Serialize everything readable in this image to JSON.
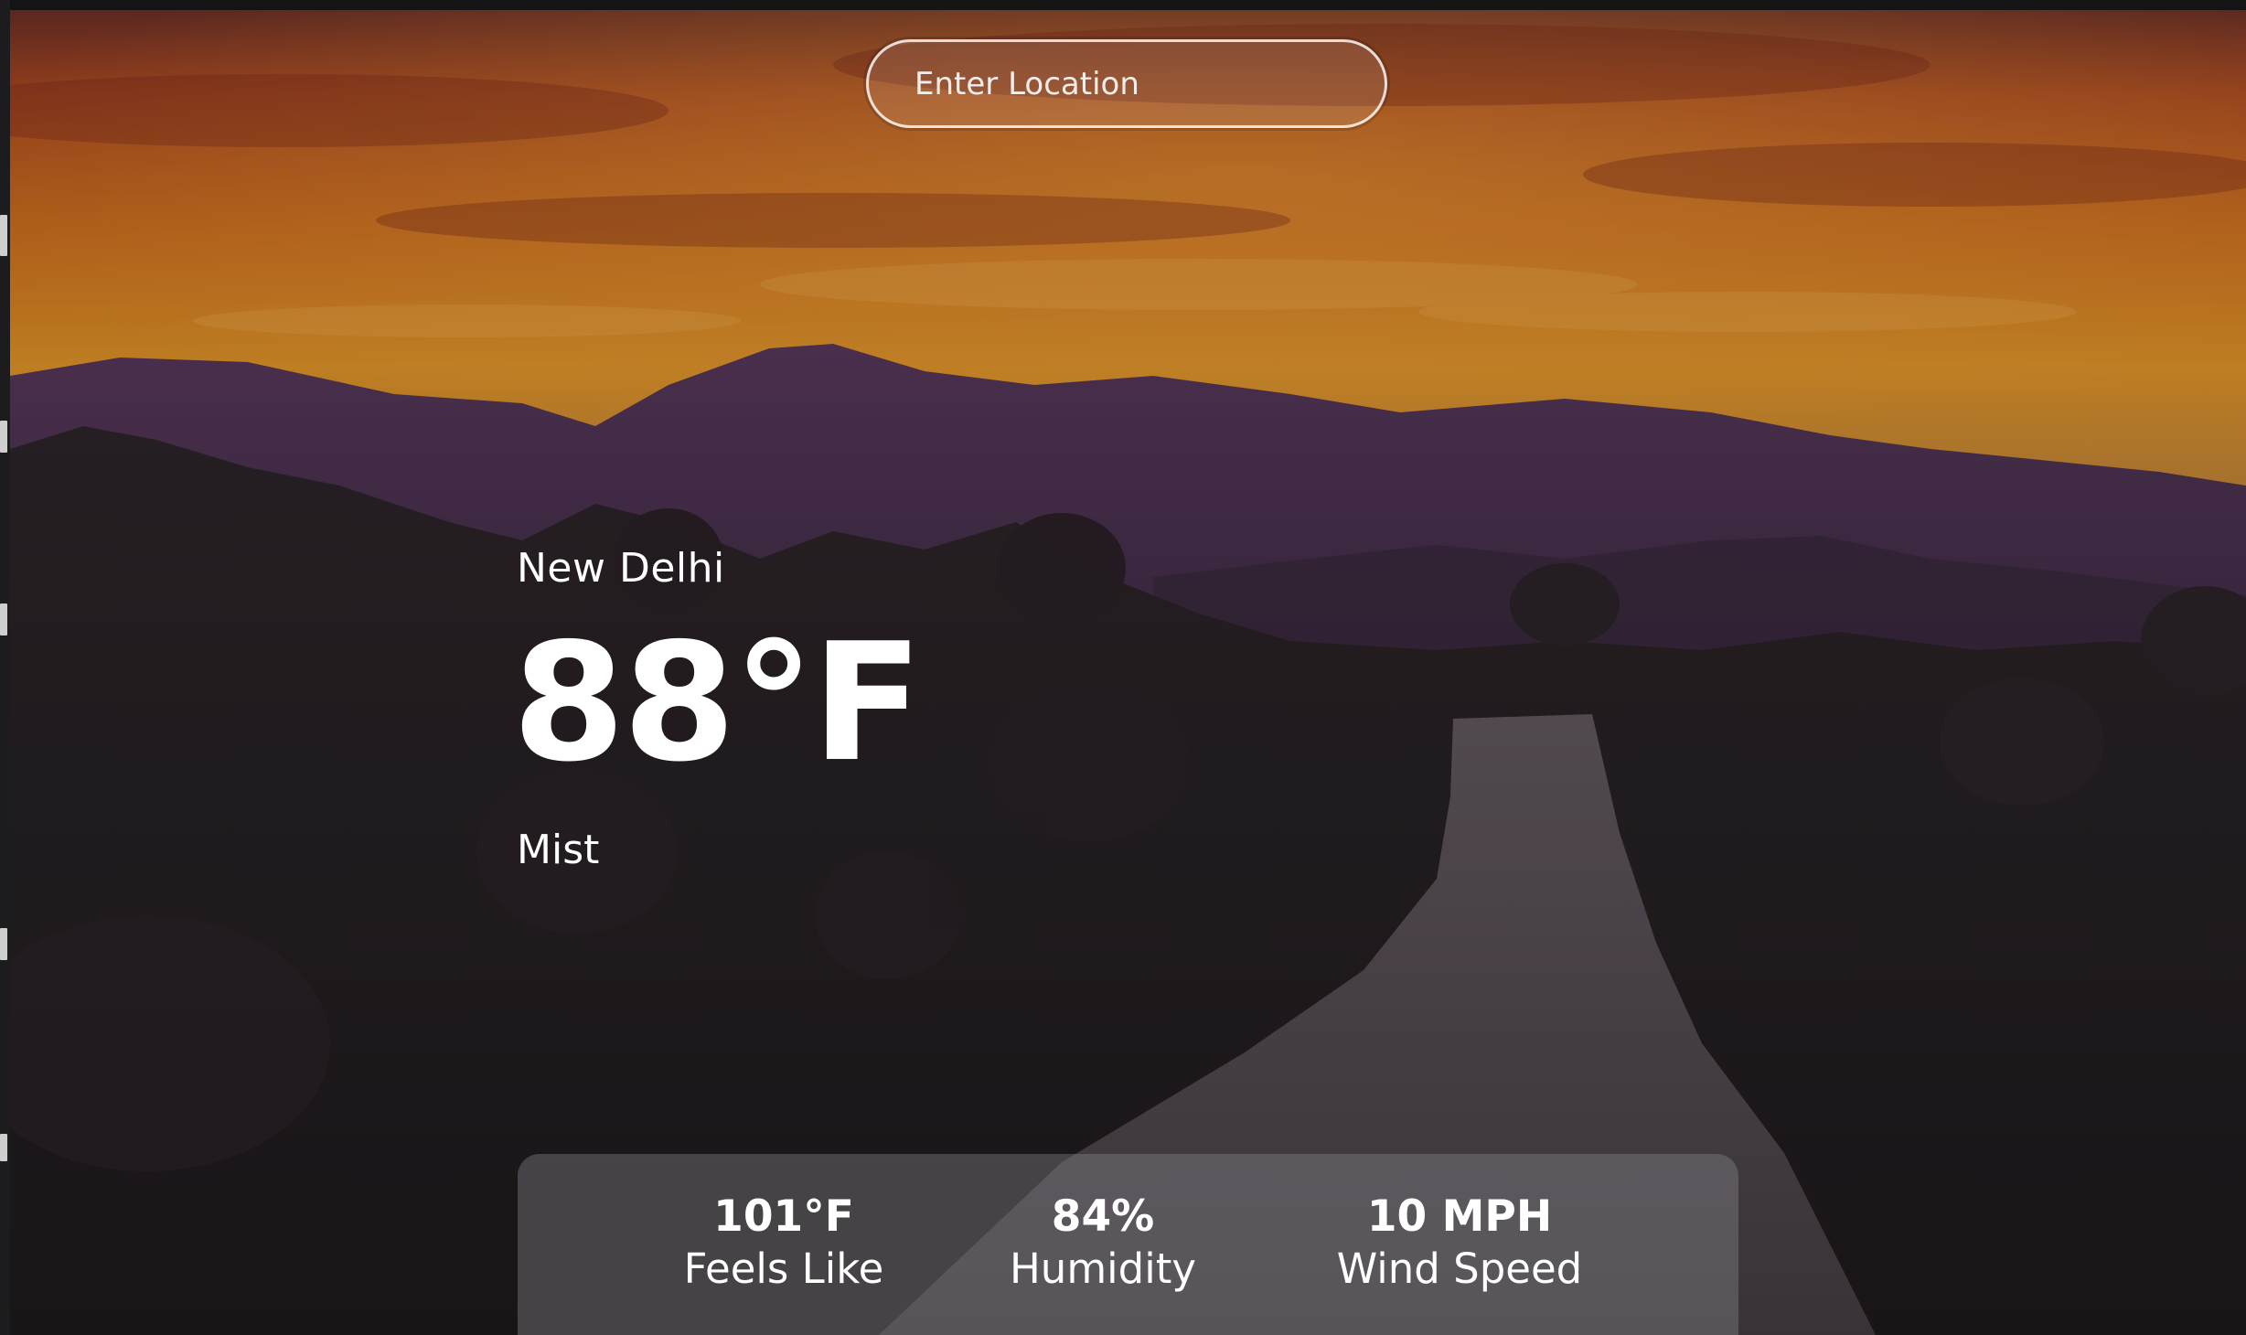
{
  "search": {
    "placeholder": "Enter Location",
    "value": ""
  },
  "weather": {
    "city": "New Delhi",
    "temperature": "88°F",
    "condition": "Mist"
  },
  "stats": {
    "feels_like": {
      "value": "101°F",
      "label": "Feels Like"
    },
    "humidity": {
      "value": "84%",
      "label": "Humidity"
    },
    "wind_speed": {
      "value": "10 MPH",
      "label": "Wind Speed"
    }
  },
  "colors": {
    "sky_top": "#b24a22",
    "sky_glow": "#e8861f",
    "mountains": "#4a3150",
    "foreground": "#2a2326",
    "card": "#82828a"
  }
}
